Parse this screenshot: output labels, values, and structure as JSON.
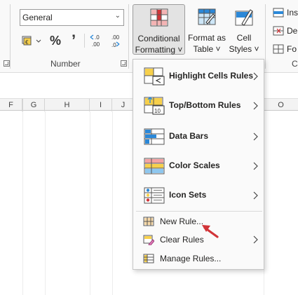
{
  "number_group": {
    "format_value": "General",
    "currency_symbol": "€",
    "percent_symbol": "%",
    "comma_symbol": "’",
    "increase_decimal_text": "←.0\n.00",
    "decrease_decimal_text": ".00\n→.0",
    "label": "Number"
  },
  "styles_group": {
    "conditional_formatting_line1": "Conditional",
    "conditional_formatting_line2": "Formatting ˅",
    "format_as_table_line1": "Format as",
    "format_as_table_line2": "Table ˅",
    "cell_styles_line1": "Cell",
    "cell_styles_line2": "Styles ˅"
  },
  "cells_group": {
    "insert_label": "Ins",
    "delete_label": "De",
    "format_label": "Fo",
    "group_label_partial": "C"
  },
  "column_headers": [
    "F",
    "G",
    "H",
    "I",
    "J",
    "O"
  ],
  "menu": {
    "items": [
      {
        "label": "Highlight Cells Rules",
        "icon": "highlight-cells-icon",
        "submenu": true
      },
      {
        "label": "Top/Bottom Rules",
        "icon": "top-bottom-icon",
        "submenu": true
      },
      {
        "label": "Data Bars",
        "icon": "data-bars-icon",
        "submenu": true
      },
      {
        "label": "Color Scales",
        "icon": "color-scales-icon",
        "submenu": true
      },
      {
        "label": "Icon Sets",
        "icon": "icon-sets-icon",
        "submenu": true
      },
      {
        "label": "New Rule...",
        "icon": "new-rule-icon",
        "submenu": false
      },
      {
        "label": "Clear Rules",
        "icon": "clear-rules-icon",
        "submenu": true
      },
      {
        "label": "Manage Rules...",
        "icon": "manage-rules-icon",
        "submenu": false
      }
    ]
  },
  "colors": {
    "accent_red": "#d13438",
    "accent_blue": "#2b88d8",
    "yellow": "#f7d04b",
    "ribbon_bg": "#f9f9f9"
  }
}
